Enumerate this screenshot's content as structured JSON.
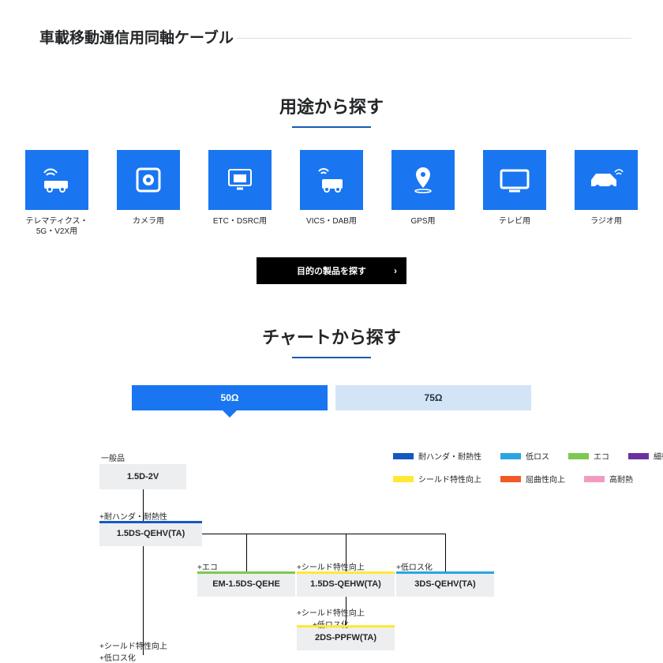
{
  "title": "車載移動通信用同軸ケーブル",
  "sections": {
    "usage": {
      "heading": "用途から探す"
    },
    "chart": {
      "heading": "チャートから探す"
    }
  },
  "tiles": [
    {
      "label": "テレマティクス・\n5G・V2X用",
      "icon": "car-signal-icon"
    },
    {
      "label": "カメラ用",
      "icon": "camera-icon"
    },
    {
      "label": "ETC・DSRC用",
      "icon": "etc-gate-icon"
    },
    {
      "label": "VICS・DAB用",
      "icon": "car-broadcast-icon"
    },
    {
      "label": "GPS用",
      "icon": "gps-pin-icon"
    },
    {
      "label": "テレビ用",
      "icon": "tv-icon"
    },
    {
      "label": "ラジオ用",
      "icon": "car-radio-icon"
    }
  ],
  "search_button": "目的の製品を探す",
  "tabs": {
    "active": "50Ω",
    "inactive": "75Ω"
  },
  "legend": [
    {
      "label": "耐ハンダ・耐熱性",
      "color": "#1558c0"
    },
    {
      "label": "低ロス",
      "color": "#2aa5e4"
    },
    {
      "label": "エコ",
      "color": "#7ec850"
    },
    {
      "label": "細径化",
      "color": "#6a329f"
    },
    {
      "label": "シールド特性向上",
      "color": "#ffe934"
    },
    {
      "label": "屈曲性向上",
      "color": "#f15a24"
    },
    {
      "label": "高耐熱",
      "color": "#f29bc1"
    }
  ],
  "groups": {
    "general": "一般品",
    "shield_lowloss": "+シールド特性向上\n+低ロス化"
  },
  "nodes": {
    "n1": {
      "name": "1.5D-2V",
      "tag": "",
      "barcolor": ""
    },
    "n2": {
      "name": "1.5DS-QEHV(TA)",
      "tag": "+耐ハンダ・耐熱性",
      "barcolor": "#1558c0"
    },
    "n3": {
      "name": "EM-1.5DS-QEHE",
      "tag": "+エコ",
      "barcolor": "#7ec850"
    },
    "n4": {
      "name": "1.5DS-QEHW(TA)",
      "tag": "+シールド特性向上",
      "barcolor": "#ffe934"
    },
    "n5": {
      "name": "3DS-QEHV(TA)",
      "tag": "+低ロス化",
      "barcolor": "#2aa5e4"
    },
    "n6": {
      "name": "2DS-PPFW(TA)",
      "tag": "+シールド特性向上\n+低ロス化",
      "barcolor": "#ffe934"
    }
  }
}
